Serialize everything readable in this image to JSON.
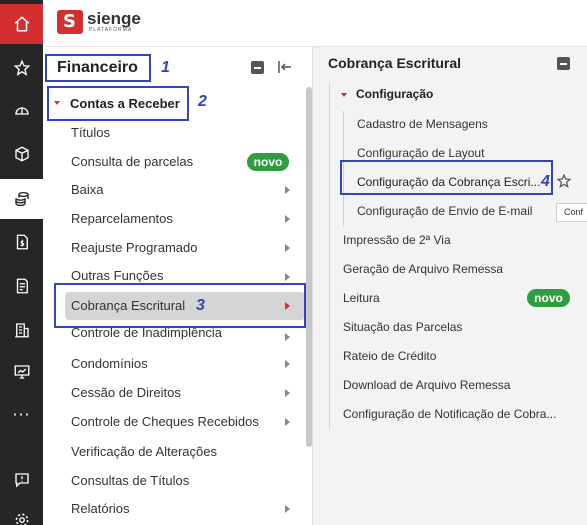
{
  "colors": {
    "accent": "#d32f2f",
    "rail_bg": "#262626",
    "badge_green": "#2e9e3e",
    "annotation_blue": "#3346b8",
    "panel2_bg": "#f3f3f3"
  },
  "rail": {
    "items": [
      {
        "icon": "home-icon"
      },
      {
        "icon": "star-icon"
      },
      {
        "icon": "helmet-icon"
      },
      {
        "icon": "box-icon"
      },
      {
        "icon": "coins-icon",
        "active": true
      },
      {
        "icon": "document-dollar-icon"
      },
      {
        "icon": "document-list-icon"
      },
      {
        "icon": "building-icon"
      },
      {
        "icon": "monitor-icon"
      },
      {
        "icon": "more-icon",
        "label": "···"
      },
      {
        "icon": "feedback-icon"
      },
      {
        "icon": "settings-icon"
      }
    ]
  },
  "header": {
    "logo_name": "sienge",
    "logo_sub": "PLATAFORMA"
  },
  "panel1": {
    "title": "Financeiro",
    "section": "Contas a Receber",
    "items": [
      {
        "label": "Títulos",
        "arrow": false
      },
      {
        "label": "Consulta de parcelas",
        "arrow": false,
        "badge": "novo"
      },
      {
        "label": "Baixa",
        "arrow": true
      },
      {
        "label": "Reparcelamentos",
        "arrow": true
      },
      {
        "label": "Reajuste Programado",
        "arrow": true
      },
      {
        "label": "Outras Funções",
        "arrow": true
      },
      {
        "label": "Cobrança Escritural",
        "arrow": true,
        "selected": true
      },
      {
        "label": "Controle de Inadimplência",
        "arrow": true
      },
      {
        "label": "Condomínios",
        "arrow": true
      },
      {
        "label": "Cessão de Direitos",
        "arrow": true
      },
      {
        "label": "Controle de Cheques Recebidos",
        "arrow": true
      },
      {
        "label": "Verificação de Alterações",
        "arrow": false
      },
      {
        "label": "Consultas de Títulos",
        "arrow": false
      },
      {
        "label": "Relatórios",
        "arrow": true
      }
    ]
  },
  "panel2": {
    "title": "Cobrança Escritural",
    "section": "Configuração",
    "sub_items": [
      "Cadastro de Mensagens",
      "Configuração de Layout",
      "Configuração da Cobrança Escri...",
      "Configuração de Envio de E-mail"
    ],
    "items": [
      {
        "label": "Impressão de 2ª Via"
      },
      {
        "label": "Geração de Arquivo Remessa"
      },
      {
        "label": "Leitura",
        "badge": "novo"
      },
      {
        "label": "Situação das Parcelas"
      },
      {
        "label": "Rateio de Crédito"
      },
      {
        "label": "Download de Arquivo Remessa"
      },
      {
        "label": "Configuração de Notificação de Cobra..."
      }
    ]
  },
  "tooltip": "Conf",
  "annotations": [
    "1",
    "2",
    "3",
    "4"
  ]
}
